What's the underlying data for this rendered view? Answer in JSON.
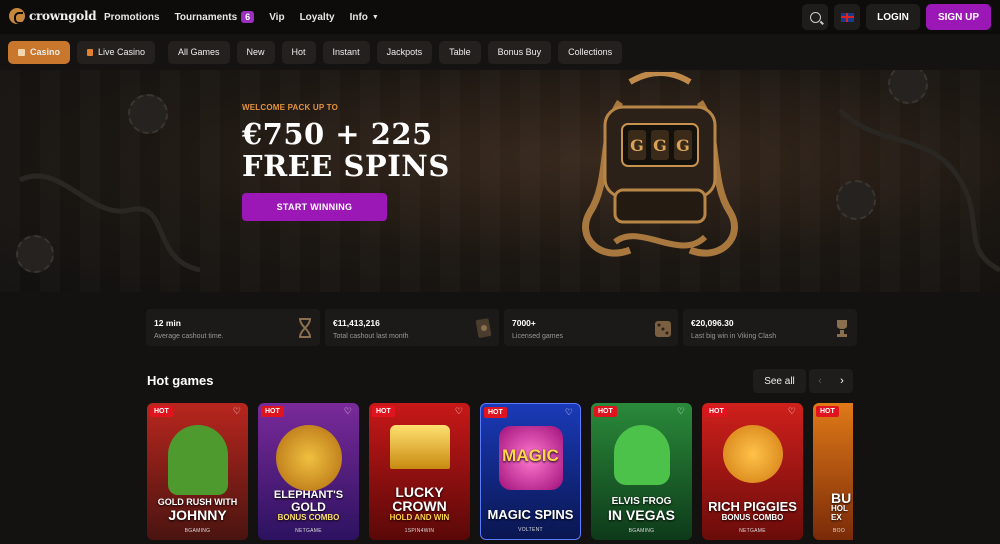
{
  "header": {
    "brand": "crowngold",
    "nav": [
      {
        "label": "Promotions"
      },
      {
        "label": "Tournaments",
        "badge": "6"
      },
      {
        "label": "Vip"
      },
      {
        "label": "Loyalty"
      },
      {
        "label": "Info"
      }
    ],
    "login_label": "LOGIN",
    "signup_label": "SIGN UP",
    "language_icon": "uk-flag-icon",
    "accent_color": "#9b18b7"
  },
  "categories": [
    {
      "label": "Casino",
      "active": true
    },
    {
      "label": "Live Casino"
    },
    {
      "label": "All Games"
    },
    {
      "label": "New"
    },
    {
      "label": "Hot"
    },
    {
      "label": "Instant"
    },
    {
      "label": "Jackpots"
    },
    {
      "label": "Table"
    },
    {
      "label": "Bonus Buy"
    },
    {
      "label": "Collections"
    }
  ],
  "hero": {
    "eyebrow": "WELCOME PACK UP TO",
    "headline_line1": "€750 + 225",
    "headline_line2": "FREE SPINS",
    "cta_label": "START WINNING"
  },
  "stats": [
    {
      "value": "12 min",
      "label": "Average cashout time.",
      "icon": "hourglass-icon"
    },
    {
      "value": "€11,413,216",
      "label": "Total cashout last month",
      "icon": "cash-icon"
    },
    {
      "value": "7000+",
      "label": "Licensed games",
      "icon": "dice-icon"
    },
    {
      "value": "€20,096.30",
      "label": "Last big win in Viking Clash",
      "icon": "trophy-icon"
    }
  ],
  "hot_games": {
    "title": "Hot games",
    "see_all_label": "See all",
    "tag": "HOT",
    "games": [
      {
        "line1": "GOLD RUSH WITH",
        "line2": "JOHNNY",
        "provider": "BGAMING"
      },
      {
        "line1": "ELEPHANT'S",
        "line2": "GOLD",
        "sub": "BONUS COMBO",
        "provider": "NETGAME"
      },
      {
        "line1": "LUCKY",
        "line2": "CROWN",
        "sub": "HOLD AND WIN",
        "provider": "1SPIN4WIN"
      },
      {
        "line1": "MAGIC SPINS",
        "line2": "",
        "provider": "VOLTENT",
        "logo": "MAGIC"
      },
      {
        "line1": "ELVIS FROG",
        "line2": "IN VEGAS",
        "provider": "BGAMING"
      },
      {
        "line1": "RICH PIGGIES",
        "line2": "",
        "sub": "BONUS COMBO",
        "provider": "NETGAME"
      },
      {
        "line1": "BU",
        "line2": "HOL",
        "sub": "EX",
        "provider": "BOO"
      }
    ]
  }
}
